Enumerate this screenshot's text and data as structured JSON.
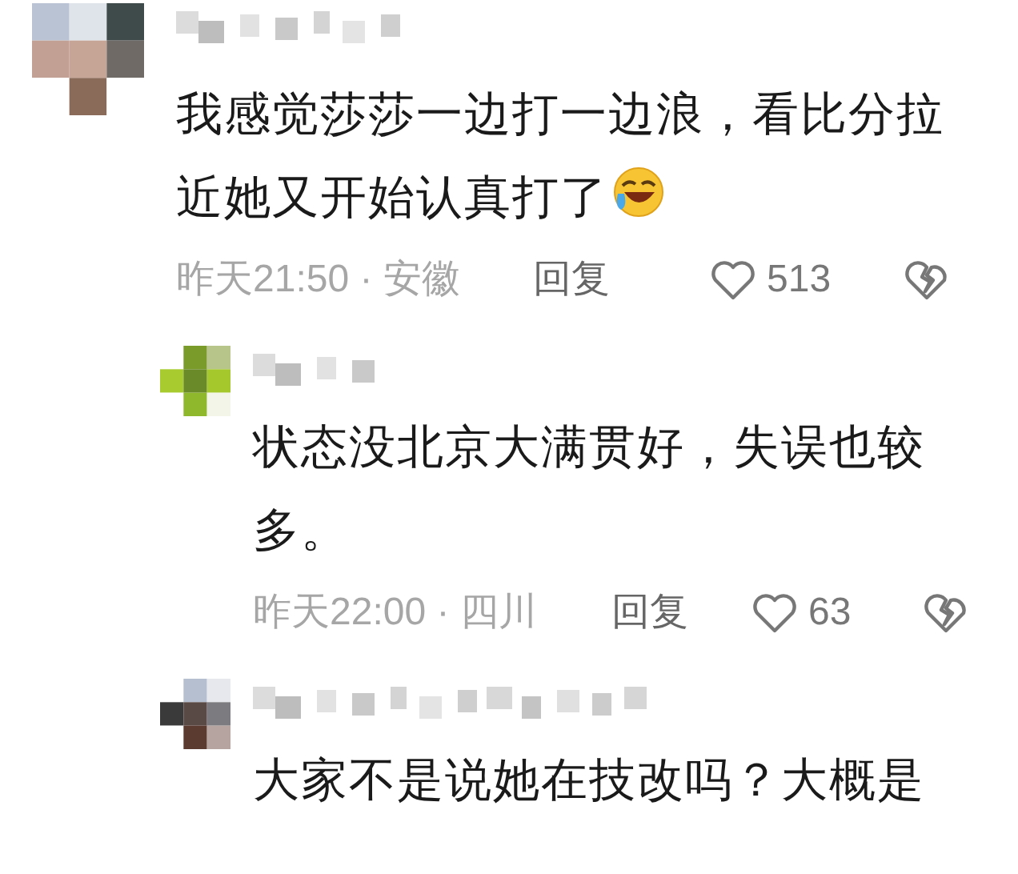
{
  "comments": [
    {
      "kind": "top",
      "text": "我感觉莎莎一边打一边浪，看比分拉近她又开始认真打了",
      "emoji": true,
      "meta": "昨天21:50 · 安徽",
      "reply_label": "回复",
      "likes": "513"
    },
    {
      "kind": "reply",
      "text": "状态没北京大满贯好，失误也较多。",
      "emoji": false,
      "meta": "昨天22:00 · 四川",
      "reply_label": "回复",
      "likes": "63"
    },
    {
      "kind": "reply",
      "text": "大家不是说她在技改吗？大概是",
      "emoji": false
    }
  ]
}
